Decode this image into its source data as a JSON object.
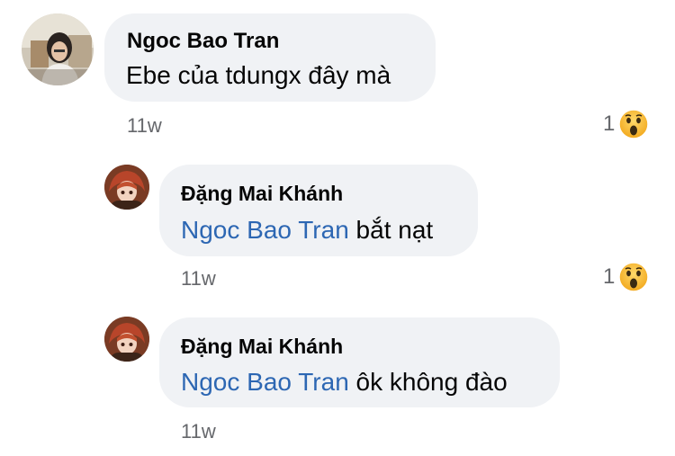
{
  "comments": [
    {
      "author": "Ngoc Bao Tran",
      "mention": "",
      "text": "Ebe của tdungx đây mà",
      "time": "11w",
      "reaction_count": "1",
      "reaction_icon": "wow-reaction-icon"
    },
    {
      "author": "Đặng Mai Khánh",
      "mention": "Ngoc Bao Tran",
      "text": " bắt nạt",
      "time": "11w",
      "reaction_count": "1",
      "reaction_icon": "wow-reaction-icon"
    },
    {
      "author": "Đặng Mai Khánh",
      "mention": "Ngoc Bao Tran",
      "text": " ôk không đào",
      "time": "11w"
    }
  ],
  "colors": {
    "bubble": "#f0f2f5",
    "mention": "#2d67b3",
    "meta": "#65676b",
    "reaction": "#f7b125"
  }
}
